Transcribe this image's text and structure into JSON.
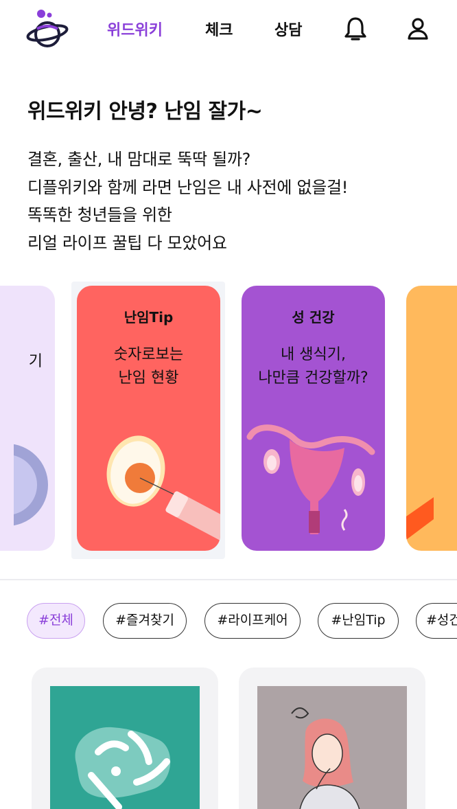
{
  "header": {
    "logo_icon": "planet-logo-icon",
    "nav": [
      {
        "label": "위드위키",
        "active": true
      },
      {
        "label": "체크",
        "active": false
      },
      {
        "label": "상담",
        "active": false
      }
    ],
    "notification_icon": "bell-icon",
    "profile_icon": "user-icon"
  },
  "intro": {
    "headline": "위드위키 안녕? 난임 잘가~",
    "lines": [
      "결혼, 출산, 내 맘대로 뚝딱 될까?",
      "디플위키와 함께 라면 난임은 내 사전에 없을걸!",
      "똑똑한 청년들을 위한",
      "리얼 라이프 꿀팁 다 모았어요"
    ]
  },
  "carousel": {
    "cards": [
      {
        "label": "",
        "title_partial": "기",
        "color": "#efe3fb"
      },
      {
        "label": "난임Tip",
        "title_lines": [
          "숫자로보는",
          "난임 현황"
        ],
        "color": "#ff6460",
        "selected": true
      },
      {
        "label": "성 건강",
        "title_lines": [
          "내 생식기,",
          "나만큼 건강할까?"
        ],
        "color": "#a453d2"
      },
      {
        "label": "",
        "color": "#ffb95c"
      }
    ]
  },
  "tags": [
    {
      "label": "#전체",
      "active": true
    },
    {
      "label": "#즐겨찾기",
      "active": false
    },
    {
      "label": "#라이프케어",
      "active": false
    },
    {
      "label": "#난임Tip",
      "active": false
    },
    {
      "label": "#성건",
      "active": false
    }
  ],
  "colors": {
    "accent": "#8a3fd9",
    "tip_card": "#ff6460",
    "health_card": "#a453d2",
    "thumb_teal": "#2fa594",
    "thumb_gray": "#ada3a5"
  }
}
